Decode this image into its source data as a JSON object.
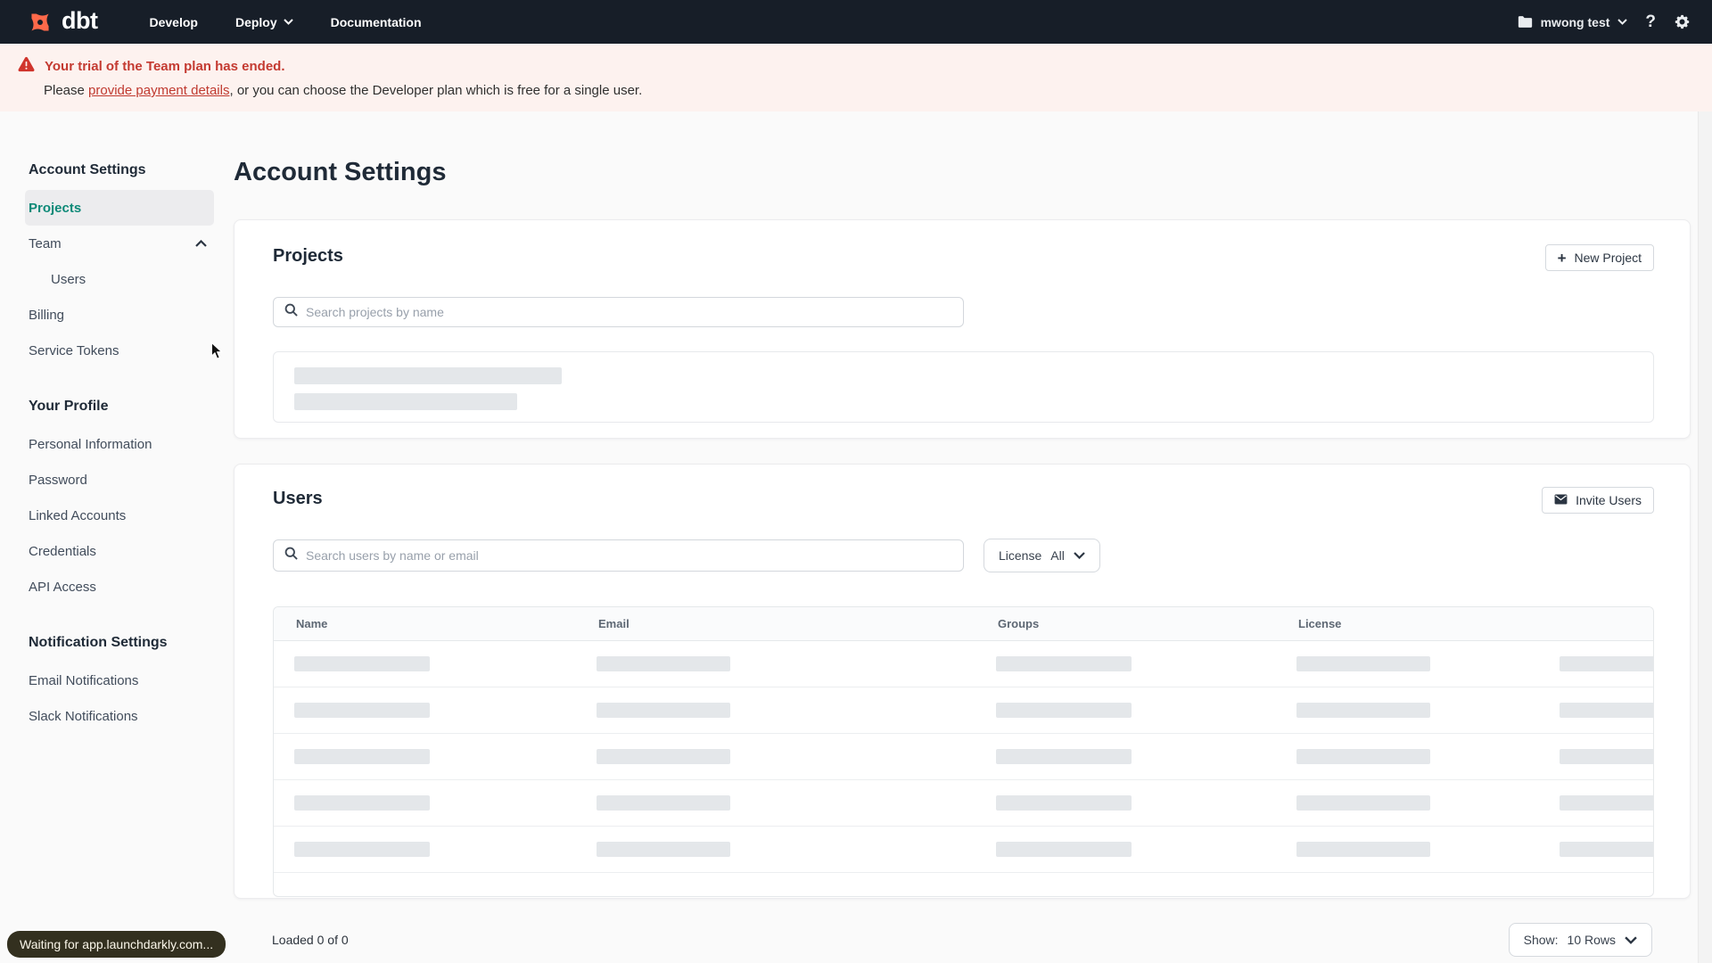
{
  "navbar": {
    "logo_text": "dbt",
    "items": [
      {
        "label": "Develop",
        "has_dropdown": false
      },
      {
        "label": "Deploy",
        "has_dropdown": true
      },
      {
        "label": "Documentation",
        "has_dropdown": false
      }
    ],
    "account": {
      "label": "mwong test"
    },
    "help_glyph": "?"
  },
  "banner": {
    "title": "Your trial of the Team plan has ended.",
    "body_prefix": "Please ",
    "link_text": "provide payment details",
    "body_suffix": ", or you can choose the Developer plan which is free for a single user."
  },
  "sidebar": {
    "sections": [
      {
        "heading": "Account Settings",
        "items": [
          {
            "label": "Projects",
            "active": true
          },
          {
            "label": "Team",
            "chevron": "up"
          },
          {
            "label": "Users",
            "indent": true
          },
          {
            "label": "Billing"
          },
          {
            "label": "Service Tokens"
          }
        ]
      },
      {
        "heading": "Your Profile",
        "items": [
          {
            "label": "Personal Information"
          },
          {
            "label": "Password"
          },
          {
            "label": "Linked Accounts"
          },
          {
            "label": "Credentials"
          },
          {
            "label": "API Access"
          }
        ]
      },
      {
        "heading": "Notification Settings",
        "items": [
          {
            "label": "Email Notifications"
          },
          {
            "label": "Slack Notifications"
          }
        ]
      }
    ]
  },
  "main": {
    "title": "Account Settings",
    "projects_section": {
      "heading": "Projects",
      "new_project_button": "New Project",
      "search_placeholder": "Search projects by name",
      "loading_skeleton_bars": 2
    },
    "users_section": {
      "heading": "Users",
      "invite_button": "Invite Users",
      "search_placeholder": "Search users by name or email",
      "license_filter": {
        "label": "License",
        "value": "All"
      },
      "table": {
        "columns": [
          "Name",
          "Email",
          "Groups",
          "License"
        ],
        "skeleton_rows": 5,
        "skeleton_bars_per_row": 5
      },
      "footer": {
        "loaded_text": "Loaded 0 of 0",
        "show_label": "Show:",
        "show_value": "10 Rows"
      }
    }
  },
  "status_bar": {
    "text": "Waiting for app.launchdarkly.com..."
  },
  "colors": {
    "navbar_bg": "#171e28",
    "brand_orange": "#ff694a",
    "banner_bg": "#fdf2ef",
    "alert_red": "#c43a31",
    "active_teal": "#0e8a78",
    "heading_navy": "#1f2a37",
    "page_bg": "#fafafa",
    "skeleton_gray": "#e4e7ea"
  }
}
